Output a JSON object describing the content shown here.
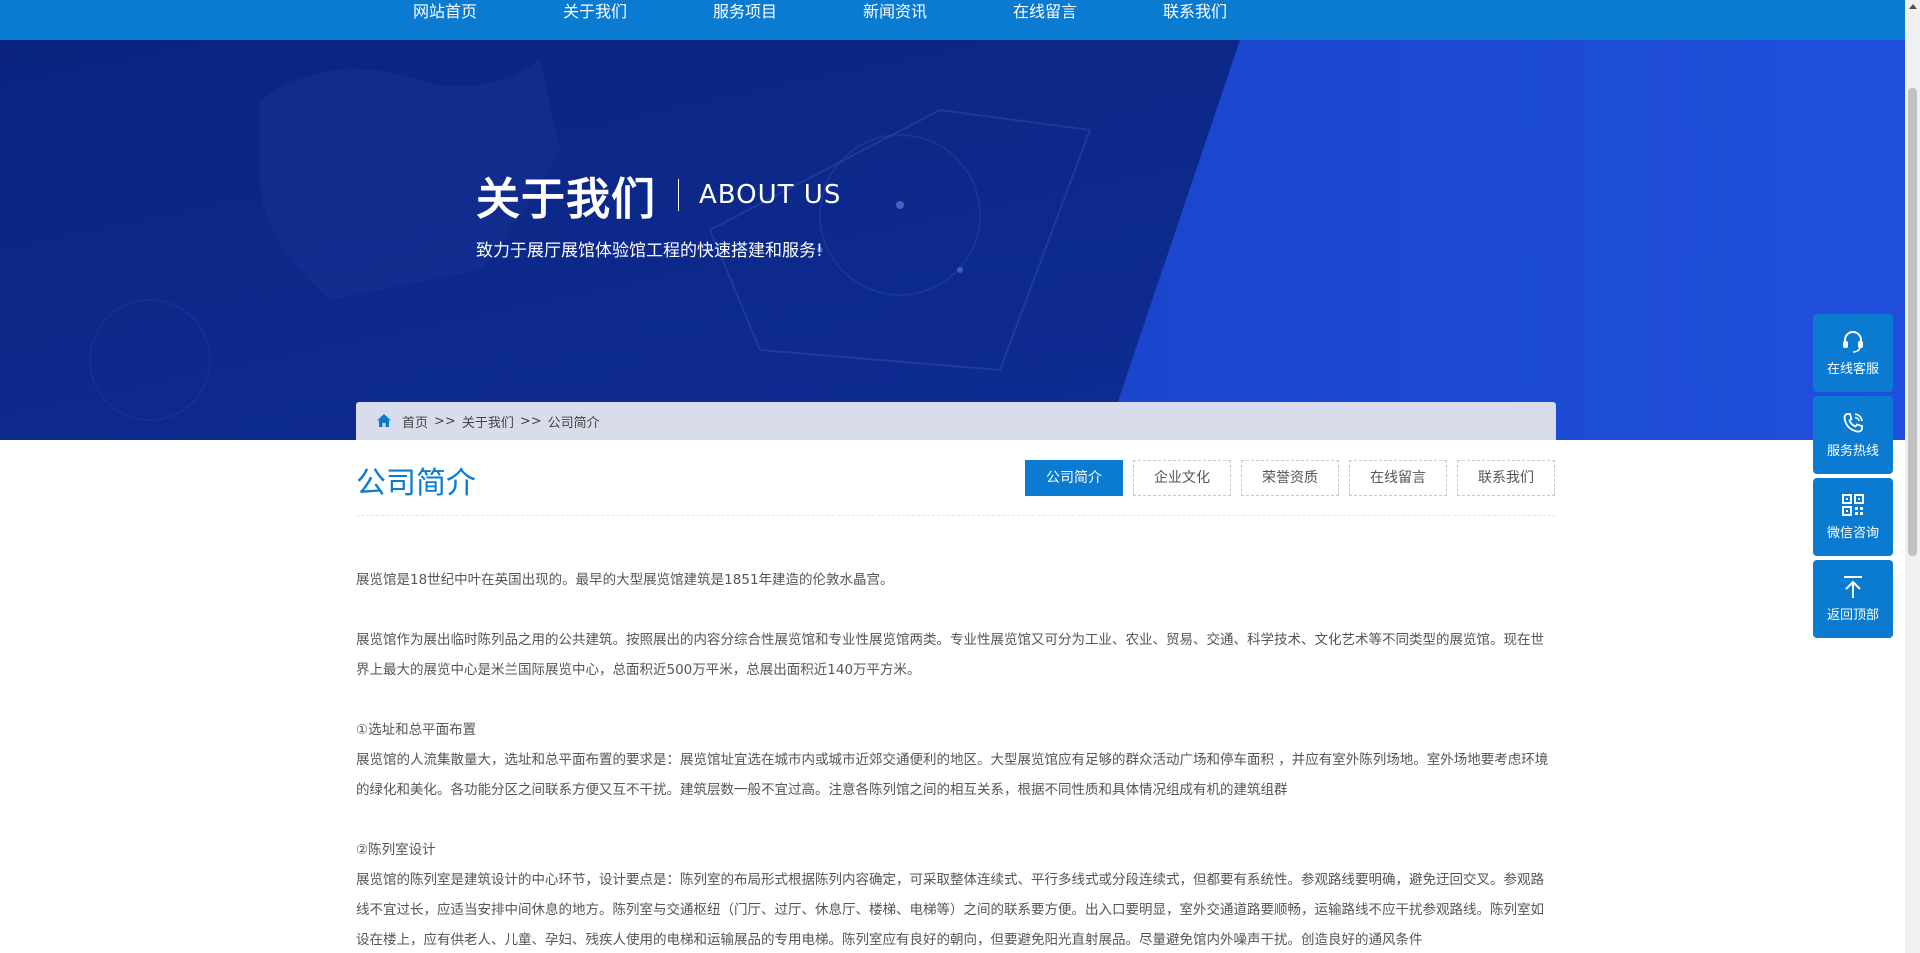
{
  "nav": {
    "items": [
      "网站首页",
      "关于我们",
      "服务项目",
      "新闻资讯",
      "在线留言",
      "联系我们"
    ]
  },
  "banner": {
    "title_cn": "关于我们",
    "title_en": "ABOUT US",
    "subtitle": "致力于展厅展馆体验馆工程的快速搭建和服务!"
  },
  "breadcrumb": {
    "home": "首页",
    "sep1": ">>",
    "level2": "关于我们",
    "sep2": ">>",
    "current": "公司简介"
  },
  "section": {
    "title": "公司简介",
    "tabs": [
      "公司简介",
      "企业文化",
      "荣誉资质",
      "在线留言",
      "联系我们"
    ],
    "active_tab": "公司简介"
  },
  "article": {
    "p1": "展览馆是18世纪中叶在英国出现的。最早的大型展览馆建筑是1851年建造的伦敦水晶宫。",
    "p2": "展览馆作为展出临时陈列品之用的公共建筑。按照展出的内容分综合性展览馆和专业性展览馆两类。专业性展览馆又可分为工业、农业、贸易、交通、科学技术、文化艺术等不同类型的展览馆。现在世界上最大的展览中心是米兰国际展览中心，总面积近500万平米，总展出面积近140万平方米。",
    "h1": "①选址和总平面布置",
    "p3": "展览馆的人流集散量大，选址和总平面布置的要求是：展览馆址宜选在城市内或城市近郊交通便利的地区。大型展览馆应有足够的群众活动广场和停车面积 ，并应有室外陈列场地。室外场地要考虑环境的绿化和美化。各功能分区之间联系方便又互不干扰。建筑层数一般不宜过高。注意各陈列馆之间的相互关系，根据不同性质和具体情况组成有机的建筑组群",
    "h2": "②陈列室设计",
    "p4": "展览馆的陈列室是建筑设计的中心环节，设计要点是：陈列室的布局形式根据陈列内容确定，可采取整体连续式、平行多线式或分段连续式，但都要有系统性。参观路线要明确，避免迂回交叉。参观路线不宜过长，应适当安排中间休息的地方。陈列室与交通枢纽（门厅、过厅、休息厅、楼梯、电梯等）之间的联系要方便。出入口要明显，室外交通道路要顺畅，运输路线不应干扰参观路线。陈列室如设在楼上，应有供老人、儿童、孕妇、残疾人使用的电梯和运输展品的专用电梯。陈列室应有良好的朝向，但要避免阳光直射展品。尽量避免馆内外噪声干扰。创造良好的通风条件"
  },
  "sidebar": {
    "service": "在线客服",
    "hotline": "服务热线",
    "wechat": "微信咨询",
    "top": "返回顶部"
  },
  "colors": {
    "primary": "#0a7bd1",
    "banner_dark": "#0d2a8f",
    "banner_light": "#1d4bd6"
  }
}
